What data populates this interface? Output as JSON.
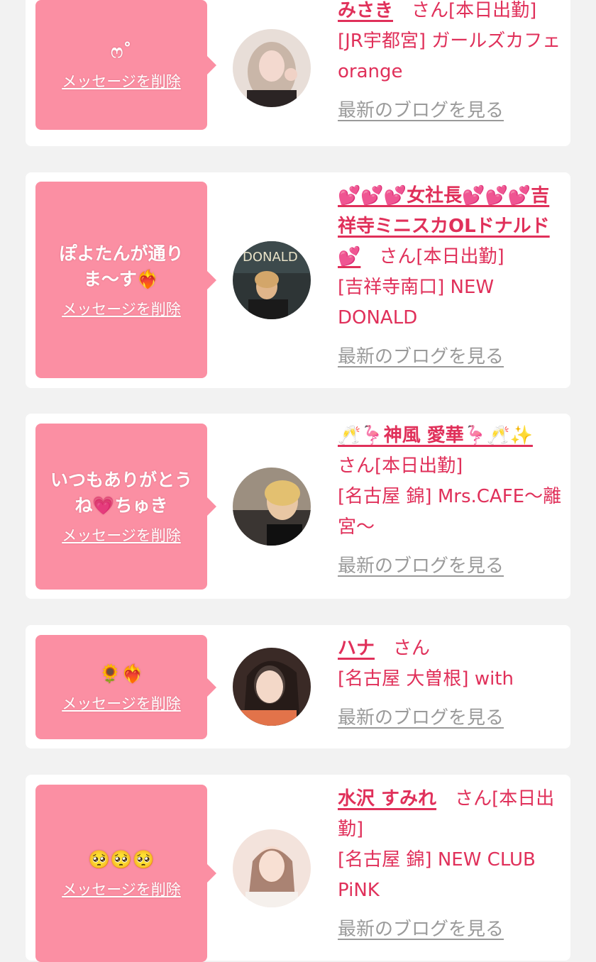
{
  "messages": [
    {
      "text": "ෆ˚",
      "delete_label": "メッセージを削除",
      "avatar": "portrait-1",
      "name": "みさき",
      "honorific": "さん",
      "status": "[本日出勤]",
      "shop": "[JR宇都宮] ガールズカフェ orange",
      "blog_link": "最新のブログを見る"
    },
    {
      "text": "ぽよたんが通りま〜す❤️‍🔥",
      "delete_label": "メッセージを削除",
      "avatar": "portrait-2",
      "name": "💕💕💕女社長💕💕💕吉祥寺ミニスカOLドナルド💕",
      "honorific": "さん",
      "status": "[本日出勤]",
      "shop": "[吉祥寺南口] NEW DONALD",
      "blog_link": "最新のブログを見る"
    },
    {
      "text": "いつもありがとうね💗ちゅき",
      "delete_label": "メッセージを削除",
      "avatar": "portrait-3",
      "name": "🥂🦩神風 愛華🦩🥂✨",
      "honorific": "さん",
      "status": "[本日出勤]",
      "shop": "[名古屋 錦] Mrs.CAFE〜離宮〜",
      "blog_link": "最新のブログを見る"
    },
    {
      "text": "🌻❤️‍🔥",
      "delete_label": "メッセージを削除",
      "avatar": "portrait-4",
      "name": "ハナ",
      "honorific": "さん",
      "status": "",
      "shop": "[名古屋 大曽根] with",
      "blog_link": "最新のブログを見る"
    },
    {
      "text": "🥺🥺🥺",
      "delete_label": "メッセージを削除",
      "avatar": "portrait-5",
      "name": "水沢 すみれ",
      "honorific": "さん",
      "status": "[本日出勤]",
      "shop": "[名古屋 錦] NEW CLUB PiNK",
      "blog_link": "最新のブログを見る"
    }
  ],
  "colors": {
    "page_background": "#f2f2f2",
    "bubble": "#fb8fa3",
    "accent_text": "#e0305a",
    "link_gray": "#9a9a9a"
  }
}
